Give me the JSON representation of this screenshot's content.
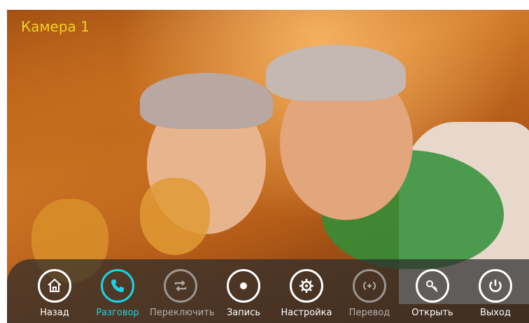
{
  "camera": {
    "title": "Камера 1"
  },
  "toolbar": {
    "accent_color": "#19d4e6",
    "buttons": [
      {
        "label": "Назад",
        "icon": "home-icon",
        "state": "normal"
      },
      {
        "label": "Разговор",
        "icon": "phone-icon",
        "state": "active"
      },
      {
        "label": "Переключить",
        "icon": "switch-arrows-icon",
        "state": "dim"
      },
      {
        "label": "Запись",
        "icon": "record-icon",
        "state": "normal"
      },
      {
        "label": "Настройка",
        "icon": "gear-icon",
        "state": "normal"
      },
      {
        "label": "Перевод",
        "icon": "transfer-icon",
        "state": "dim"
      },
      {
        "label": "Открыть",
        "icon": "key-icon",
        "state": "normal"
      },
      {
        "label": "Выход",
        "icon": "power-icon",
        "state": "normal"
      }
    ]
  }
}
